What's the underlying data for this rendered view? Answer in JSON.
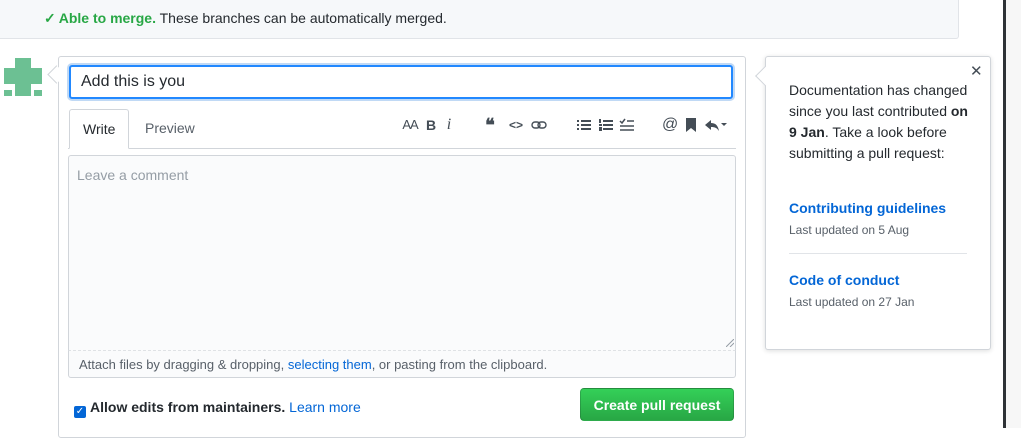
{
  "merge": {
    "status": "Able to merge.",
    "message": "These branches can be automatically merged."
  },
  "title_input": {
    "value": "Add this is you"
  },
  "tabs": [
    {
      "label": "Write",
      "active": true
    },
    {
      "label": "Preview",
      "active": false
    }
  ],
  "toolbar_icons": [
    "text-size-icon",
    "bold-icon",
    "italic-icon",
    "quote-icon",
    "code-icon",
    "link-icon",
    "bulleted-list-icon",
    "numbered-list-icon",
    "task-list-icon",
    "mention-icon",
    "saved-reply-icon",
    "reply-dropdown-icon"
  ],
  "toolbar_glyphs": {
    "text_size": "AA",
    "bold": "B",
    "italic": "i",
    "quote": "❝",
    "code": "<>",
    "mention": "@"
  },
  "comment": {
    "placeholder": "Leave a comment"
  },
  "attach": {
    "prefix": "Attach files by dragging & dropping, ",
    "link": "selecting them",
    "suffix": ", or pasting from the clipboard."
  },
  "allow_edits": {
    "checked": true,
    "label": "Allow edits from maintainers.",
    "learn_more": "Learn more"
  },
  "create_button": {
    "label": "Create pull request"
  },
  "popover": {
    "text_before": "Documentation has changed since you last contributed ",
    "text_bold": "on 9 Jan",
    "text_after": ". Take a look before submitting a pull request:",
    "links": [
      {
        "label": "Contributing guidelines",
        "updated": "Last updated on 5 Aug"
      },
      {
        "label": "Code of conduct",
        "updated": "Last updated on 27 Jan"
      }
    ]
  },
  "colors": {
    "accent_blue": "#0366d6",
    "merge_green": "#28a745",
    "button_green": "#2ea44f",
    "avatar_green": "#6cc093"
  }
}
